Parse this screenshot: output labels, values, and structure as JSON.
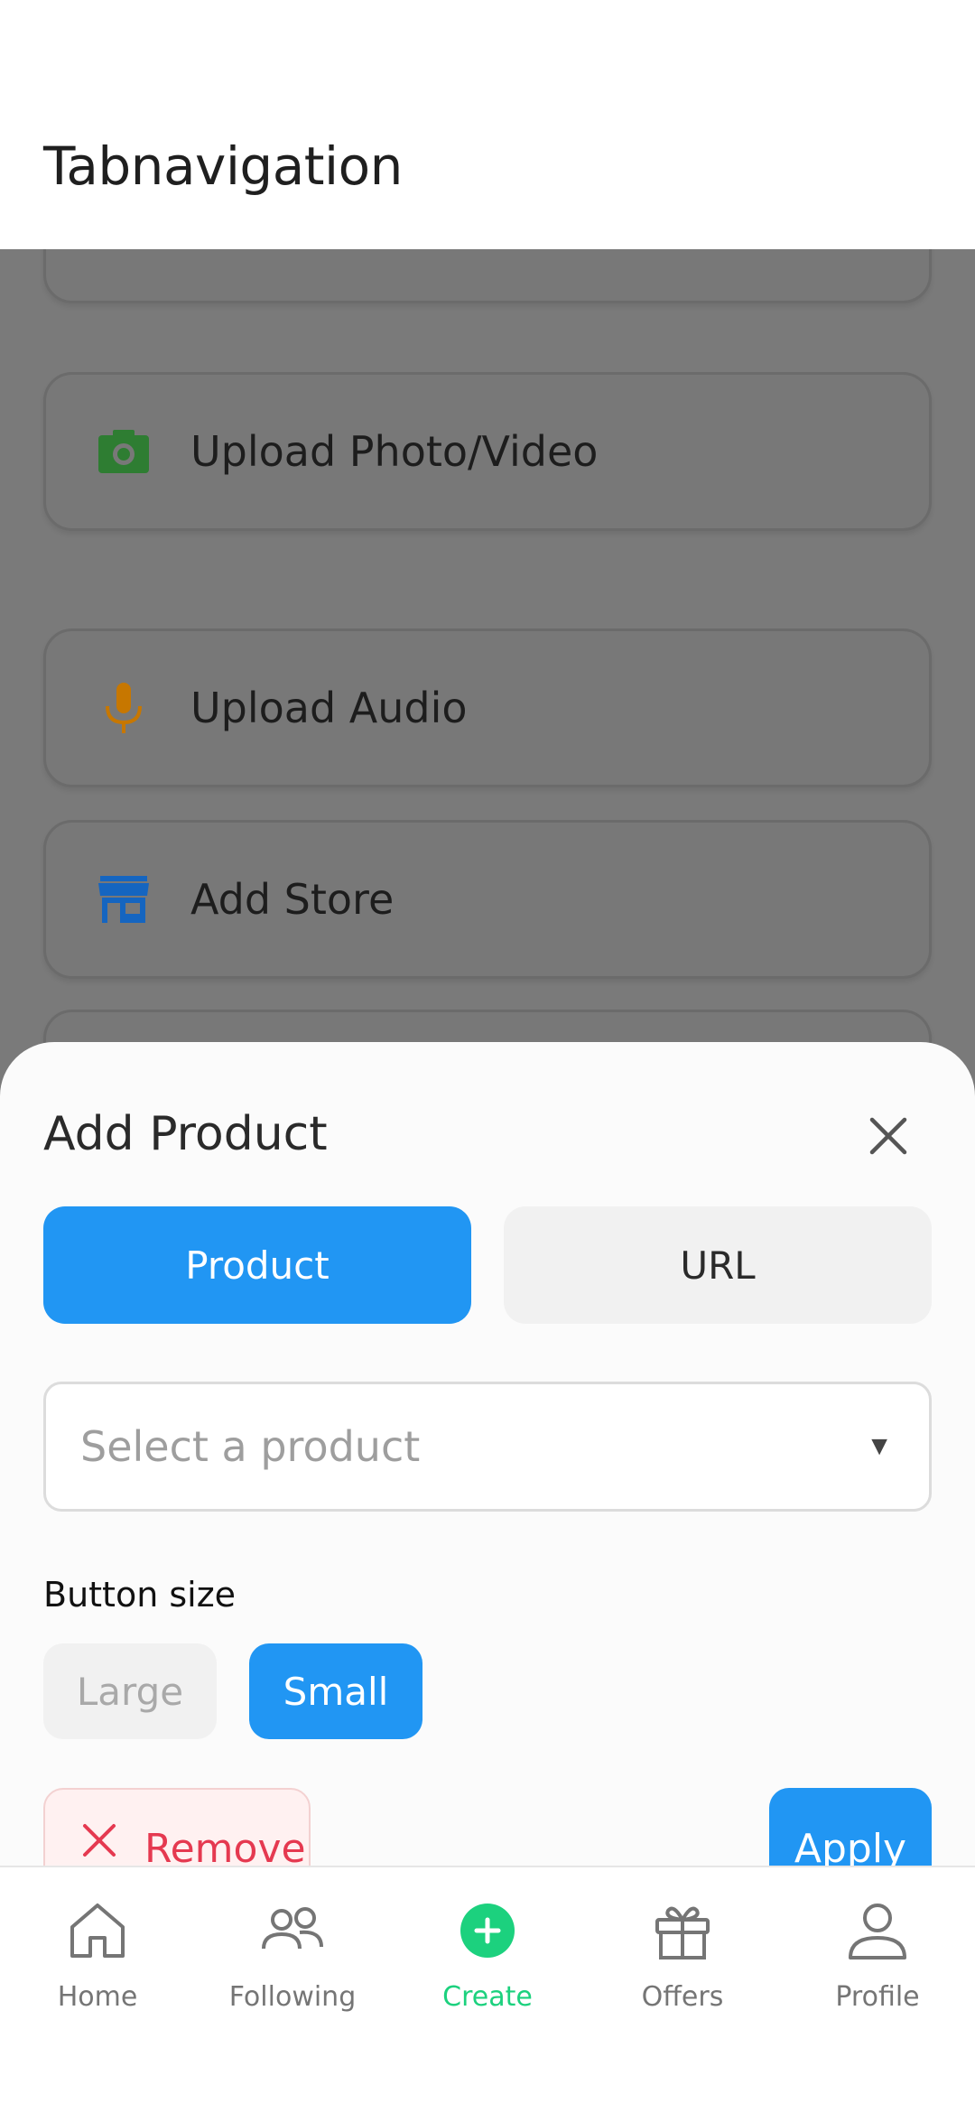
{
  "header": {
    "title": "Tabnavigation"
  },
  "background_list": {
    "items": [
      {
        "label": "",
        "icon": "none"
      },
      {
        "label": "Upload Photo/Video",
        "icon": "camera-icon",
        "color": "#2e7d32"
      },
      {
        "label": "Upload Audio",
        "icon": "microphone-icon",
        "color": "#c77700"
      },
      {
        "label": "Add Store",
        "icon": "store-icon",
        "color": "#1565c0"
      },
      {
        "label": "",
        "icon": "none"
      }
    ]
  },
  "sheet": {
    "title": "Add Product",
    "tabs": [
      {
        "label": "Product",
        "active": true
      },
      {
        "label": "URL",
        "active": false
      }
    ],
    "select": {
      "placeholder": "Select a product",
      "arrow": "▼"
    },
    "button_size": {
      "label": "Button size",
      "options": [
        {
          "label": "Large",
          "selected": false
        },
        {
          "label": "Small",
          "selected": true
        }
      ]
    },
    "remove_label": "Remove",
    "apply_label": "Apply"
  },
  "tabbar": {
    "items": [
      {
        "label": "Home",
        "icon": "home-icon",
        "active": false
      },
      {
        "label": "Following",
        "icon": "people-icon",
        "active": false
      },
      {
        "label": "Create",
        "icon": "plus-circle-icon",
        "active": true
      },
      {
        "label": "Offers",
        "icon": "gift-icon",
        "active": false
      },
      {
        "label": "Profile",
        "icon": "user-icon",
        "active": false
      }
    ]
  },
  "colors": {
    "primary": "#2196f3",
    "accent_green": "#1cd17e",
    "danger": "#e53950"
  }
}
